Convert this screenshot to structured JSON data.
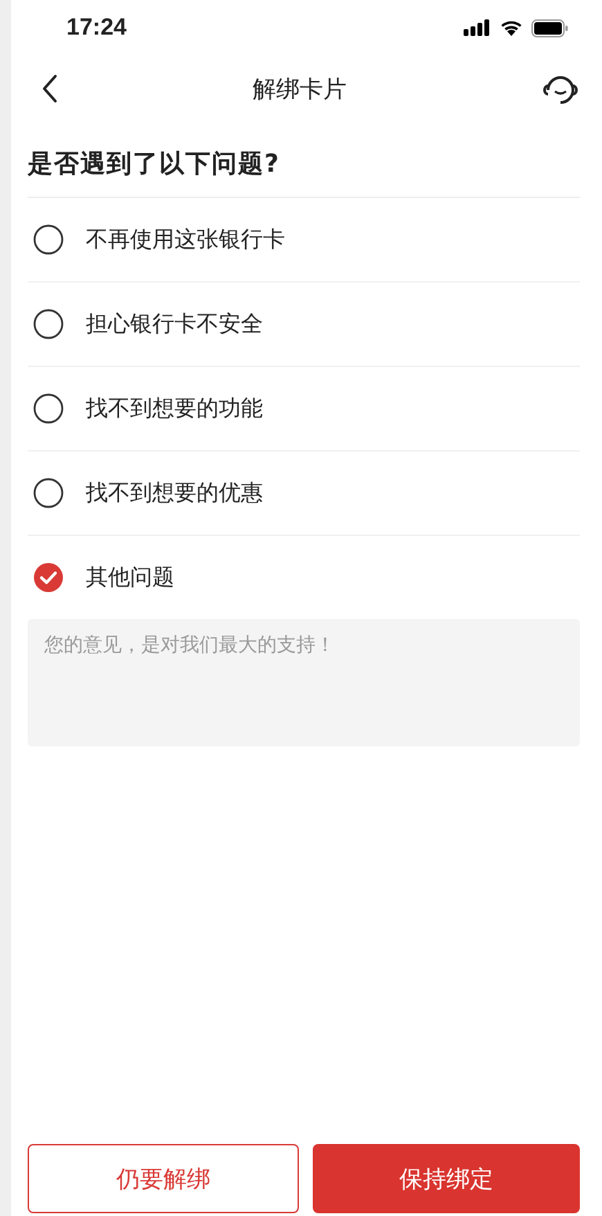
{
  "status_bar": {
    "time": "17:24"
  },
  "nav": {
    "title": "解绑卡片"
  },
  "question": "是否遇到了以下问题?",
  "options": [
    {
      "label": "不再使用这张银行卡",
      "selected": false
    },
    {
      "label": "担心银行卡不安全",
      "selected": false
    },
    {
      "label": "找不到想要的功能",
      "selected": false
    },
    {
      "label": "找不到想要的优惠",
      "selected": false
    },
    {
      "label": "其他问题",
      "selected": true
    }
  ],
  "feedback": {
    "placeholder": "您的意见，是对我们最大的支持！"
  },
  "buttons": [
    {
      "label": "仍要解绑",
      "kind": "outline"
    },
    {
      "label": "保持绑定",
      "kind": "filled"
    }
  ]
}
